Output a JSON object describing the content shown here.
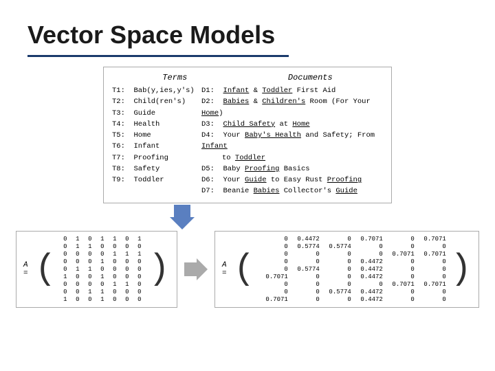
{
  "title": "Vector Space Models",
  "table": {
    "header_terms": "Terms",
    "header_docs": "Documents",
    "terms": [
      {
        "id": "T1:",
        "label": "Bab(y,ies,y's)"
      },
      {
        "id": "T2:",
        "label": "Child(ren's)"
      },
      {
        "id": "T3:",
        "label": "Guide"
      },
      {
        "id": "T4:",
        "label": "Health"
      },
      {
        "id": "T5:",
        "label": "Home"
      },
      {
        "id": "T6:",
        "label": "Infant"
      },
      {
        "id": "T7:",
        "label": "Proofing"
      },
      {
        "id": "T8:",
        "label": "Safety"
      },
      {
        "id": "T9:",
        "label": "Toddler"
      }
    ],
    "docs": [
      {
        "id": "D1:",
        "text": "Infant & Toddler First Aid"
      },
      {
        "id": "D2:",
        "text": "Babies & Children's Room (For Your Home)"
      },
      {
        "id": "D3:",
        "text": "Child Safety at Home"
      },
      {
        "id": "D4:",
        "text": "Your Baby's Health and Safety; From Infant to Toddler"
      },
      {
        "id": "D5:",
        "text": "Baby Proofing Basics"
      },
      {
        "id": "D6:",
        "text": "Your Guide to Easy Rust Proofing"
      },
      {
        "id": "D7:",
        "text": "Beanie Babies Collector's Guide"
      }
    ]
  },
  "matrix_A_label": "A =",
  "matrix_A_rows": [
    [
      0,
      1,
      0,
      1,
      1,
      0,
      1
    ],
    [
      0,
      1,
      1,
      0,
      0,
      0,
      0
    ],
    [
      0,
      0,
      0,
      0,
      1,
      1,
      1
    ],
    [
      0,
      0,
      0,
      1,
      0,
      0,
      0
    ],
    [
      0,
      1,
      1,
      0,
      0,
      0,
      0
    ],
    [
      1,
      0,
      0,
      1,
      0,
      0,
      0
    ],
    [
      0,
      0,
      0,
      0,
      1,
      1,
      0
    ],
    [
      0,
      0,
      1,
      1,
      0,
      0,
      0
    ],
    [
      1,
      0,
      0,
      1,
      0,
      0,
      0
    ]
  ],
  "approx": "≈",
  "matrix_A2_label": "A =",
  "matrix_A2_rows": [
    [
      0,
      0.4472,
      0,
      0.7071,
      0,
      0.7071
    ],
    [
      0,
      0.5774,
      0.5774,
      0,
      0,
      0
    ],
    [
      0,
      0,
      0,
      0,
      0.7071,
      0.7071
    ],
    [
      0,
      0,
      0,
      0.4472,
      0,
      0
    ],
    [
      0,
      0.5774,
      0,
      0.4472,
      0,
      0
    ],
    [
      0.7071,
      0,
      0,
      0.4472,
      0,
      0
    ],
    [
      0,
      0,
      0,
      0,
      0.7071,
      0.7071
    ],
    [
      0,
      0,
      0.5774,
      0.4472,
      0,
      0
    ],
    [
      0.7071,
      0,
      0,
      0.4472,
      0,
      0
    ]
  ]
}
